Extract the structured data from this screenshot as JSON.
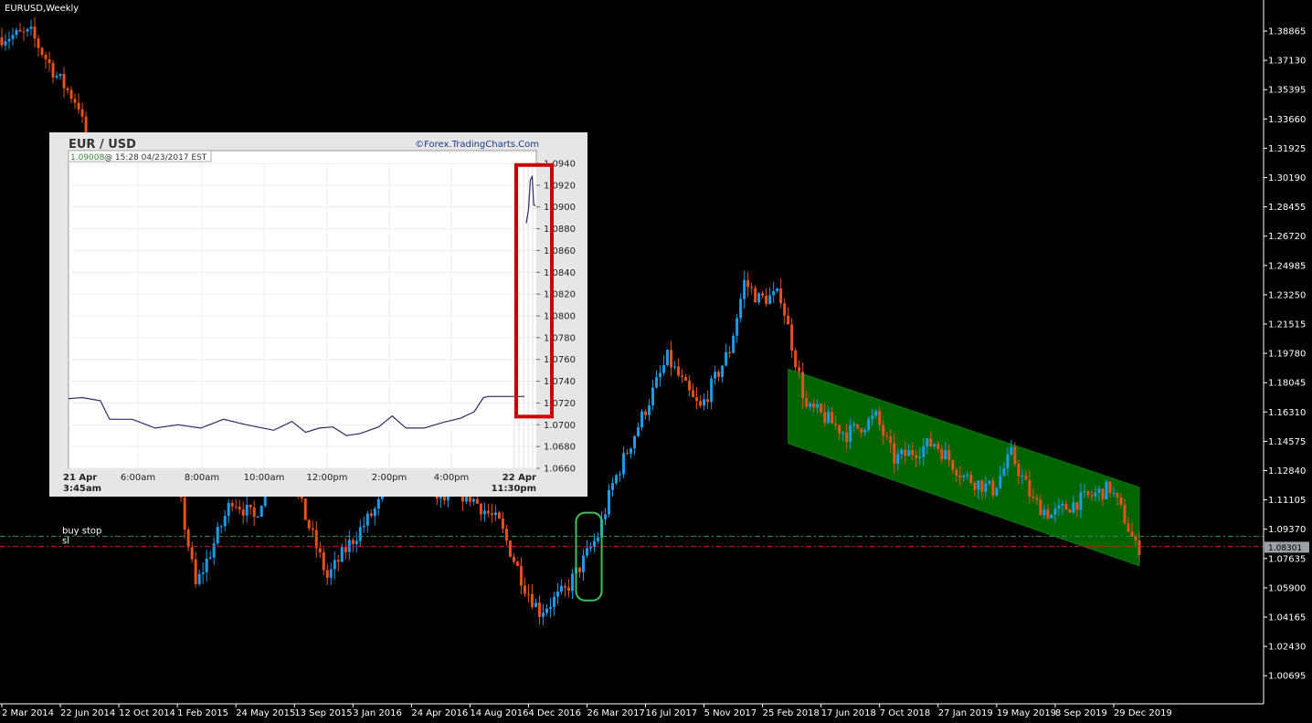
{
  "window": {
    "symbol_title": "EURUSD,Weekly"
  },
  "colors": {
    "background": "#000000",
    "bull": "#1e9be6",
    "bear": "#e8501e",
    "channel": "#006400",
    "buy_stop_line": "#2e8b57",
    "sl_line": "#cc2222",
    "price_box": "#9aa0a6",
    "highlight_green": "#3fbf5a",
    "highlight_red": "#cc0000"
  },
  "chart_data": [
    {
      "type": "line",
      "title": "EURUSD,Weekly",
      "price_ticks": [
        "1.38865",
        "1.37130",
        "1.35395",
        "1.33660",
        "1.31925",
        "1.30190",
        "1.28455",
        "1.26720",
        "1.24985",
        "1.23250",
        "1.21515",
        "1.19780",
        "1.18045",
        "1.16310",
        "1.14575",
        "1.12840",
        "1.11105",
        "1.09370",
        "1.07635",
        "1.05900",
        "1.04165",
        "1.02430",
        "1.00695"
      ],
      "current_price": "1.08301",
      "date_ticks": [
        "2 Mar 2014",
        "22 Jun 2014",
        "12 Oct 2014",
        "1 Feb 2015",
        "24 May 2015",
        "13 Sep 2015",
        "3 Jan 2016",
        "24 Apr 2016",
        "14 Aug 2016",
        "4 Dec 2016",
        "26 Mar 2017",
        "16 Jul 2017",
        "5 Nov 2017",
        "25 Feb 2018",
        "17 Jun 2018",
        "7 Oct 2018",
        "27 Jan 2019",
        "19 May 2019",
        "8 Sep 2019",
        "29 Dec 2019"
      ],
      "x_anchor_dates": [
        "2014-03-02",
        "2014-06-22",
        "2014-10-12",
        "2015-02-01",
        "2015-05-24",
        "2015-09-13",
        "2016-01-03",
        "2016-04-24",
        "2016-08-14",
        "2016-12-04",
        "2017-03-26",
        "2017-07-16",
        "2017-11-05",
        "2018-02-25",
        "2018-06-17",
        "2018-10-07",
        "2019-01-27",
        "2019-05-19",
        "2019-09-08",
        "2019-12-29"
      ],
      "price_path": [
        [
          "2014-03-02",
          1.385
        ],
        [
          "2014-05-04",
          1.387
        ],
        [
          "2014-06-22",
          1.362
        ],
        [
          "2014-08-03",
          1.345
        ],
        [
          "2014-09-07",
          1.292
        ],
        [
          "2014-10-12",
          1.265
        ],
        [
          "2014-12-07",
          1.23
        ],
        [
          "2015-01-11",
          1.185
        ],
        [
          "2015-02-01",
          1.132
        ],
        [
          "2015-03-15",
          1.06
        ],
        [
          "2015-04-12",
          1.08
        ],
        [
          "2015-05-24",
          1.112
        ],
        [
          "2015-07-05",
          1.1
        ],
        [
          "2015-08-23",
          1.14
        ],
        [
          "2015-09-13",
          1.125
        ],
        [
          "2015-11-22",
          1.065
        ],
        [
          "2016-01-03",
          1.085
        ],
        [
          "2016-02-21",
          1.105
        ],
        [
          "2016-04-24",
          1.135
        ],
        [
          "2016-06-26",
          1.11
        ],
        [
          "2016-08-14",
          1.115
        ],
        [
          "2016-10-16",
          1.097
        ],
        [
          "2016-12-04",
          1.06
        ],
        [
          "2017-01-01",
          1.045
        ],
        [
          "2017-02-19",
          1.057
        ],
        [
          "2017-03-26",
          1.075
        ],
        [
          "2017-04-23",
          1.09
        ],
        [
          "2017-05-21",
          1.12
        ],
        [
          "2017-07-16",
          1.16
        ],
        [
          "2017-09-03",
          1.195
        ],
        [
          "2017-10-22",
          1.17
        ],
        [
          "2017-11-05",
          1.165
        ],
        [
          "2017-12-31",
          1.2
        ],
        [
          "2018-01-28",
          1.24
        ],
        [
          "2018-02-25",
          1.23
        ],
        [
          "2018-04-08",
          1.232
        ],
        [
          "2018-05-27",
          1.165
        ],
        [
          "2018-06-17",
          1.163
        ],
        [
          "2018-08-12",
          1.15
        ],
        [
          "2018-10-07",
          1.16
        ],
        [
          "2018-11-11",
          1.135
        ],
        [
          "2019-01-27",
          1.145
        ],
        [
          "2019-03-24",
          1.125
        ],
        [
          "2019-05-19",
          1.117
        ],
        [
          "2019-06-23",
          1.138
        ],
        [
          "2019-08-04",
          1.11
        ],
        [
          "2019-09-08",
          1.102
        ],
        [
          "2019-10-27",
          1.11
        ],
        [
          "2019-12-29",
          1.118
        ],
        [
          "2020-01-26",
          1.1
        ],
        [
          "2020-02-16",
          1.083
        ]
      ],
      "horizontal_lines": [
        {
          "label": "buy stop",
          "price": 1.0895
        },
        {
          "label": "sl",
          "price": 1.0835
        }
      ],
      "channel": {
        "start_date": "2018-04-15",
        "end_date": "2020-02-16",
        "upper_start": 1.1885,
        "upper_end": 1.1185,
        "lower_start": 1.1445,
        "lower_end": 1.072
      },
      "highlight_box": {
        "start_date": "2017-03-05",
        "end_date": "2017-04-23",
        "price_high": 1.1035,
        "price_low": 1.0515
      }
    },
    {
      "type": "line",
      "title": "EUR / USD",
      "source": "©Forex.TradingCharts.Com",
      "quote": {
        "price": "1.09008",
        "info": "@ 15:28  04/23/2017 EST"
      },
      "y_ticks": [
        "1.0940",
        "1.0920",
        "1.0900",
        "1.0880",
        "1.0860",
        "1.0840",
        "1.0820",
        "1.0800",
        "1.0780",
        "1.0760",
        "1.0740",
        "1.0720",
        "1.0700",
        "1.0680",
        "1.0660"
      ],
      "ylim": [
        1.066,
        1.094
      ],
      "x_ticks": [
        {
          "label": "21 Apr",
          "sub": "3:45am"
        },
        {
          "label": "6:00am",
          "sub": ""
        },
        {
          "label": "8:00am",
          "sub": ""
        },
        {
          "label": "10:00am",
          "sub": ""
        },
        {
          "label": "12:00pm",
          "sub": ""
        },
        {
          "label": "2:00pm",
          "sub": ""
        },
        {
          "label": "4:00pm",
          "sub": ""
        },
        {
          "label": "22 Apr",
          "sub": "11:30pm"
        }
      ],
      "price_path_early": [
        [
          0,
          1.0724
        ],
        [
          0.03,
          1.0725
        ],
        [
          0.07,
          1.0722
        ],
        [
          0.09,
          1.0705
        ],
        [
          0.14,
          1.0705
        ],
        [
          0.19,
          1.0697
        ],
        [
          0.24,
          1.07
        ],
        [
          0.29,
          1.0697
        ],
        [
          0.34,
          1.0705
        ],
        [
          0.39,
          1.07
        ],
        [
          0.45,
          1.0695
        ],
        [
          0.49,
          1.0703
        ],
        [
          0.52,
          1.0693
        ],
        [
          0.55,
          1.0697
        ],
        [
          0.58,
          1.0698
        ],
        [
          0.61,
          1.069
        ],
        [
          0.64,
          1.0692
        ],
        [
          0.68,
          1.0698
        ],
        [
          0.71,
          1.0708
        ],
        [
          0.74,
          1.0697
        ],
        [
          0.78,
          1.0697
        ],
        [
          0.82,
          1.0702
        ],
        [
          0.86,
          1.0706
        ],
        [
          0.89,
          1.0712
        ],
        [
          0.91,
          1.0725
        ],
        [
          0.92,
          1.0726
        ],
        [
          1.0,
          1.0726
        ]
      ],
      "price_path_gap": [
        [
          0,
          1.0885
        ],
        [
          0.25,
          1.0898
        ],
        [
          0.45,
          1.0925
        ],
        [
          0.65,
          1.0928
        ],
        [
          0.82,
          1.0902
        ],
        [
          1.0,
          1.0901
        ]
      ],
      "gap_highlight": {
        "price_high": 1.0936,
        "price_low": 1.071
      }
    }
  ]
}
